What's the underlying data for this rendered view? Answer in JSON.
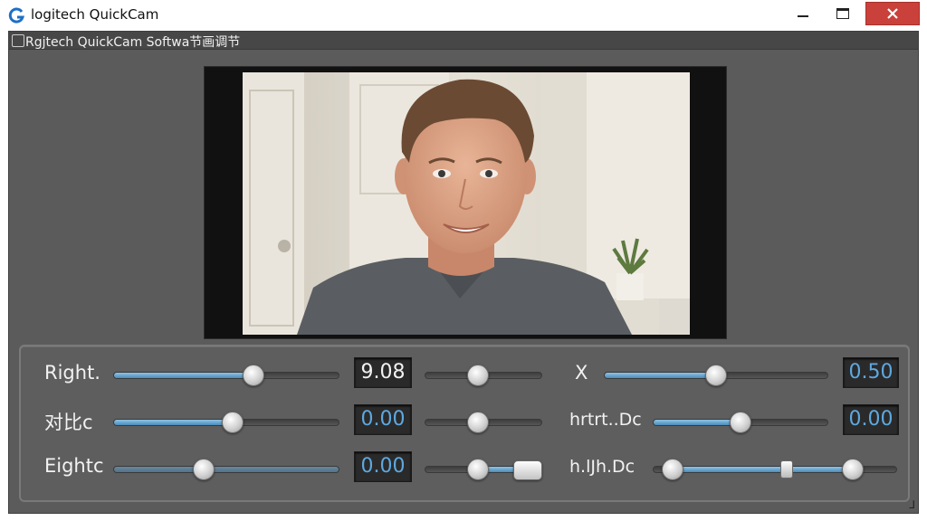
{
  "window": {
    "title": "logitech QuickCam",
    "menubar_text": "Rgjtech QuickCam Softwa节画调节",
    "resize_glyph": "⅃",
    "buttons": {
      "minimize": "minimize",
      "maximize": "maximize",
      "close": "✕"
    }
  },
  "colors": {
    "accent": "#5ea8df",
    "close_button": "#c9413a",
    "panel_bg": "#5e5e5e"
  },
  "controls": {
    "row1": {
      "label": "Right.",
      "main_slider": 0.62,
      "value": "9.08",
      "mini_slider": 0.45,
      "right_label": "X",
      "right_slider": 0.5,
      "right_value": "0.50"
    },
    "row2": {
      "label": "对比c",
      "main_slider": 0.53,
      "value": "0.00",
      "mini_slider": 0.45,
      "right_label": "hrtrt..Dc",
      "right_slider": 0.5,
      "right_value": "0.00"
    },
    "row3": {
      "label": "Eightc",
      "main_slider": 0.4,
      "value": "0.00",
      "mini_slider_low": 0.45,
      "mini_slider_high": 0.88,
      "right_label": "h.lJh.Dc",
      "right_slider_low": 0.08,
      "right_slider_mid": 0.55,
      "right_slider_high": 0.82
    }
  }
}
